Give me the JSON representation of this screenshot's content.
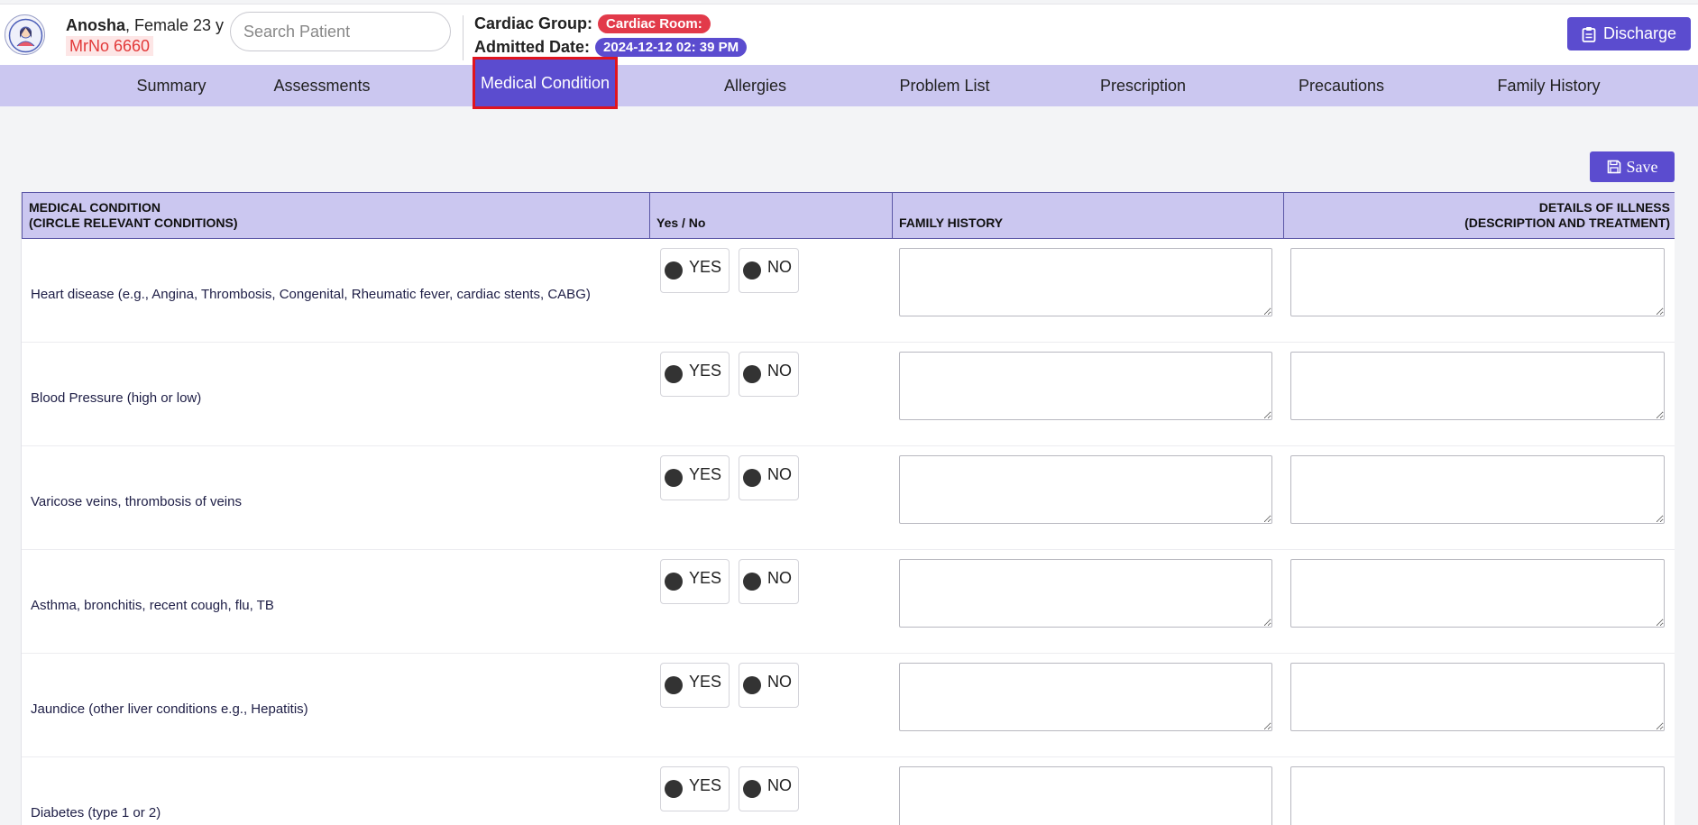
{
  "patient": {
    "name": "Anosha",
    "details": ", Female 23 y",
    "mrno": "MrNo 6660"
  },
  "search": {
    "placeholder": "Search Patient"
  },
  "admission": {
    "group_label": "Cardiac Group:",
    "room_badge": "Cardiac Room:",
    "admitted_label": "Admitted Date:",
    "admitted_value": "2024-12-12 02: 39 PM"
  },
  "actions": {
    "discharge_label": "Discharge",
    "save_label": "Save"
  },
  "tabs": [
    {
      "label": "Summary"
    },
    {
      "label": "Assessments"
    },
    {
      "label": "Medical Condition",
      "active": true
    },
    {
      "label": "Allergies"
    },
    {
      "label": "Problem List"
    },
    {
      "label": "Prescription"
    },
    {
      "label": "Precautions"
    },
    {
      "label": "Family History"
    }
  ],
  "table": {
    "headers": {
      "condition_line1": "MEDICAL CONDITION",
      "condition_line2": "(CIRCLE RELEVANT CONDITIONS)",
      "yes_no": "Yes / No",
      "family_history": "FAMILY HISTORY",
      "details_line1": "DETAILS OF ILLNESS",
      "details_line2": "(DESCRIPTION AND TREATMENT)"
    },
    "yes_label": "YES",
    "no_label": "NO",
    "rows": [
      {
        "condition": "Heart disease (e.g., Angina, Thrombosis, Congenital, Rheumatic fever, cardiac stents, CABG)"
      },
      {
        "condition": "Blood Pressure (high or low)"
      },
      {
        "condition": "Varicose veins, thrombosis of veins"
      },
      {
        "condition": "Asthma, bronchitis, recent cough, flu, TB"
      },
      {
        "condition": "Jaundice (other liver conditions e.g., Hepatitis)"
      },
      {
        "condition": "Diabetes (type 1 or 2)"
      }
    ]
  },
  "colors": {
    "accent": "#5b4ccf",
    "tab_bar": "#cbc7f0",
    "badge_red": "#e23a4a",
    "highlight": "#e0141e"
  }
}
